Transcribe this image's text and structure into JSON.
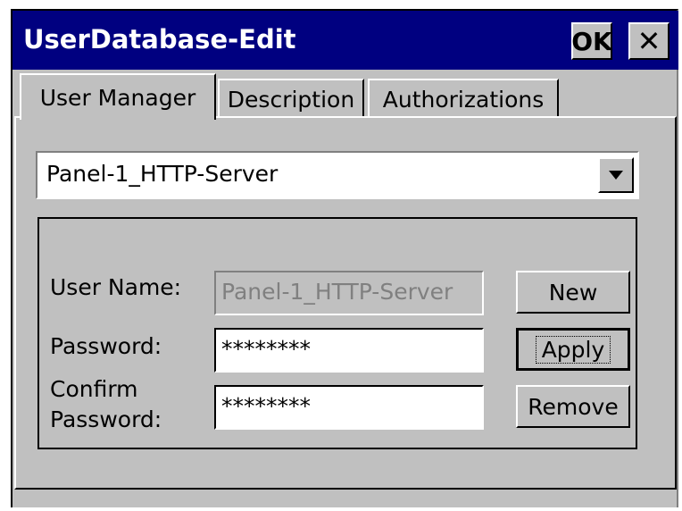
{
  "window": {
    "title": "UserDatabase-Edit",
    "ok_label": "OK",
    "close_icon": "close-icon"
  },
  "tabs": [
    {
      "label": "User Manager",
      "active": true
    },
    {
      "label": "Description",
      "active": false
    },
    {
      "label": "Authorizations",
      "active": false
    }
  ],
  "user_select": {
    "selected": "Panel-1_HTTP-Server"
  },
  "form": {
    "user_name_label": "User Name:",
    "user_name_value": "Panel-1_HTTP-Server",
    "password_label": "Password:",
    "password_value": "********",
    "confirm_label_line1": "Confirm",
    "confirm_label_line2": "Password:",
    "confirm_value": "********"
  },
  "buttons": {
    "new": "New",
    "apply": "Apply",
    "remove": "Remove"
  },
  "colors": {
    "titlebar": "#000080",
    "face": "#c0c0c0",
    "disabled_text": "#808080"
  }
}
